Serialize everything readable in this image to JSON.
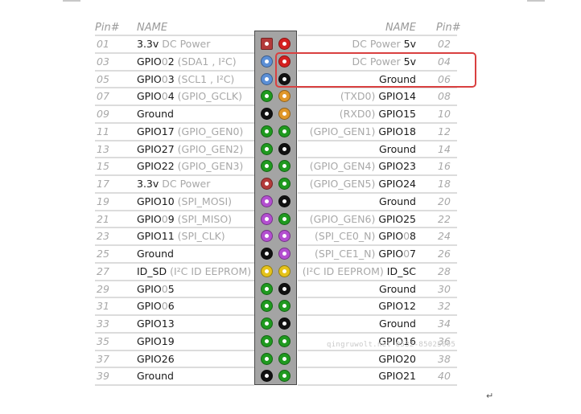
{
  "header": {
    "left_pin_label": "Pin#",
    "left_name_label": "NAME",
    "right_name_label": "NAME",
    "right_pin_label": "Pin#"
  },
  "colors": {
    "power_3v3": "#b33a3a",
    "power_5v": "#d42020",
    "ground": "#111111",
    "i2c": "#5b8fd6",
    "gpio": "#1f9a1f",
    "uart": "#e0972a",
    "spi": "#b34fd0",
    "eeprom": "#e5c21a",
    "highlight": "#d94040"
  },
  "rows": [
    {
      "left": {
        "pin": "01",
        "main": "3.3v",
        "extra": " DC Power",
        "extra_pos": "after",
        "type": "power_3v3",
        "square": true
      },
      "right": {
        "pin": "02",
        "main": "5v",
        "extra": "DC Power ",
        "extra_pos": "before",
        "type": "power_5v"
      }
    },
    {
      "left": {
        "pin": "03",
        "main": "GPIO",
        "main_dim": "0",
        "main2": "2",
        "extra": " (SDA1 , I²C)",
        "extra_pos": "after",
        "type": "i2c"
      },
      "right": {
        "pin": "04",
        "main": "5v",
        "extra": "DC Power ",
        "extra_pos": "before",
        "type": "power_5v"
      }
    },
    {
      "left": {
        "pin": "05",
        "main": "GPIO",
        "main_dim": "0",
        "main2": "3",
        "extra": " (SCL1 , I²C)",
        "extra_pos": "after",
        "type": "i2c"
      },
      "right": {
        "pin": "06",
        "main": "Ground",
        "extra": "",
        "extra_pos": "before",
        "type": "ground"
      }
    },
    {
      "left": {
        "pin": "07",
        "main": "GPIO",
        "main_dim": "0",
        "main2": "4",
        "extra": " (GPIO_GCLK)",
        "extra_pos": "after",
        "type": "gpio"
      },
      "right": {
        "pin": "08",
        "main": "GPIO14",
        "extra": "(TXD0) ",
        "extra_pos": "before",
        "type": "uart"
      }
    },
    {
      "left": {
        "pin": "09",
        "main": "Ground",
        "extra": "",
        "extra_pos": "after",
        "type": "ground"
      },
      "right": {
        "pin": "10",
        "main": "GPIO15",
        "extra": "(RXD0) ",
        "extra_pos": "before",
        "type": "uart"
      }
    },
    {
      "left": {
        "pin": "11",
        "main": "GPIO17",
        "extra": " (GPIO_GEN0)",
        "extra_pos": "after",
        "type": "gpio"
      },
      "right": {
        "pin": "12",
        "main": "GPIO18",
        "extra": "(GPIO_GEN1) ",
        "extra_pos": "before",
        "type": "gpio"
      }
    },
    {
      "left": {
        "pin": "13",
        "main": "GPIO27",
        "extra": " (GPIO_GEN2)",
        "extra_pos": "after",
        "type": "gpio"
      },
      "right": {
        "pin": "14",
        "main": "Ground",
        "extra": "",
        "extra_pos": "before",
        "type": "ground"
      }
    },
    {
      "left": {
        "pin": "15",
        "main": "GPIO22",
        "extra": " (GPIO_GEN3)",
        "extra_pos": "after",
        "type": "gpio"
      },
      "right": {
        "pin": "16",
        "main": "GPIO23",
        "extra": "(GPIO_GEN4) ",
        "extra_pos": "before",
        "type": "gpio"
      }
    },
    {
      "left": {
        "pin": "17",
        "main": "3.3v",
        "extra": " DC Power",
        "extra_pos": "after",
        "type": "power_3v3"
      },
      "right": {
        "pin": "18",
        "main": "GPIO24",
        "extra": "(GPIO_GEN5) ",
        "extra_pos": "before",
        "type": "gpio"
      }
    },
    {
      "left": {
        "pin": "19",
        "main": "GPIO10",
        "extra": " (SPI_MOSI)",
        "extra_pos": "after",
        "type": "spi"
      },
      "right": {
        "pin": "20",
        "main": "Ground",
        "extra": "",
        "extra_pos": "before",
        "type": "ground"
      }
    },
    {
      "left": {
        "pin": "21",
        "main": "GPIO",
        "main_dim": "0",
        "main2": "9",
        "extra": " (SPI_MISO)",
        "extra_pos": "after",
        "type": "spi"
      },
      "right": {
        "pin": "22",
        "main": "GPIO25",
        "extra": "(GPIO_GEN6) ",
        "extra_pos": "before",
        "type": "gpio"
      }
    },
    {
      "left": {
        "pin": "23",
        "main": "GPIO11",
        "extra": " (SPI_CLK)",
        "extra_pos": "after",
        "type": "spi"
      },
      "right": {
        "pin": "24",
        "main": "GPIO",
        "main_dim": "0",
        "main2": "8",
        "extra": "(SPI_CE0_N) ",
        "extra_pos": "before",
        "type": "spi"
      }
    },
    {
      "left": {
        "pin": "25",
        "main": "Ground",
        "extra": "",
        "extra_pos": "after",
        "type": "ground"
      },
      "right": {
        "pin": "26",
        "main": "GPIO",
        "main_dim": "0",
        "main2": "7",
        "extra": "(SPI_CE1_N) ",
        "extra_pos": "before",
        "type": "spi"
      }
    },
    {
      "left": {
        "pin": "27",
        "main": "ID_SD",
        "extra": " (I²C ID EEPROM)",
        "extra_pos": "after",
        "type": "eeprom"
      },
      "right": {
        "pin": "28",
        "main": "ID_SC",
        "extra": "(I²C ID EEPROM) ",
        "extra_pos": "before",
        "type": "eeprom"
      }
    },
    {
      "left": {
        "pin": "29",
        "main": "GPIO",
        "main_dim": "0",
        "main2": "5",
        "extra": "",
        "extra_pos": "after",
        "type": "gpio"
      },
      "right": {
        "pin": "30",
        "main": "Ground",
        "extra": "",
        "extra_pos": "before",
        "type": "ground"
      }
    },
    {
      "left": {
        "pin": "31",
        "main": "GPIO",
        "main_dim": "0",
        "main2": "6",
        "extra": "",
        "extra_pos": "after",
        "type": "gpio"
      },
      "right": {
        "pin": "32",
        "main": "GPIO12",
        "extra": "",
        "extra_pos": "before",
        "type": "gpio"
      }
    },
    {
      "left": {
        "pin": "33",
        "main": "GPIO13",
        "extra": "",
        "extra_pos": "after",
        "type": "gpio"
      },
      "right": {
        "pin": "34",
        "main": "Ground",
        "extra": "",
        "extra_pos": "before",
        "type": "ground"
      }
    },
    {
      "left": {
        "pin": "35",
        "main": "GPIO19",
        "extra": "",
        "extra_pos": "after",
        "type": "gpio"
      },
      "right": {
        "pin": "36",
        "main": "GPIO16",
        "extra": "",
        "extra_pos": "before",
        "type": "gpio"
      }
    },
    {
      "left": {
        "pin": "37",
        "main": "GPIO26",
        "extra": "",
        "extra_pos": "after",
        "type": "gpio"
      },
      "right": {
        "pin": "38",
        "main": "GPIO20",
        "extra": "",
        "extra_pos": "before",
        "type": "gpio"
      }
    },
    {
      "left": {
        "pin": "39",
        "main": "Ground",
        "extra": "",
        "extra_pos": "after",
        "type": "ground"
      },
      "right": {
        "pin": "40",
        "main": "GPIO21",
        "extra": "",
        "extra_pos": "before",
        "type": "gpio"
      }
    }
  ],
  "highlighted_pins": [
    "04",
    "06"
  ],
  "watermark": "qingruwolt.net 0532-85025005",
  "return_mark": "↵"
}
